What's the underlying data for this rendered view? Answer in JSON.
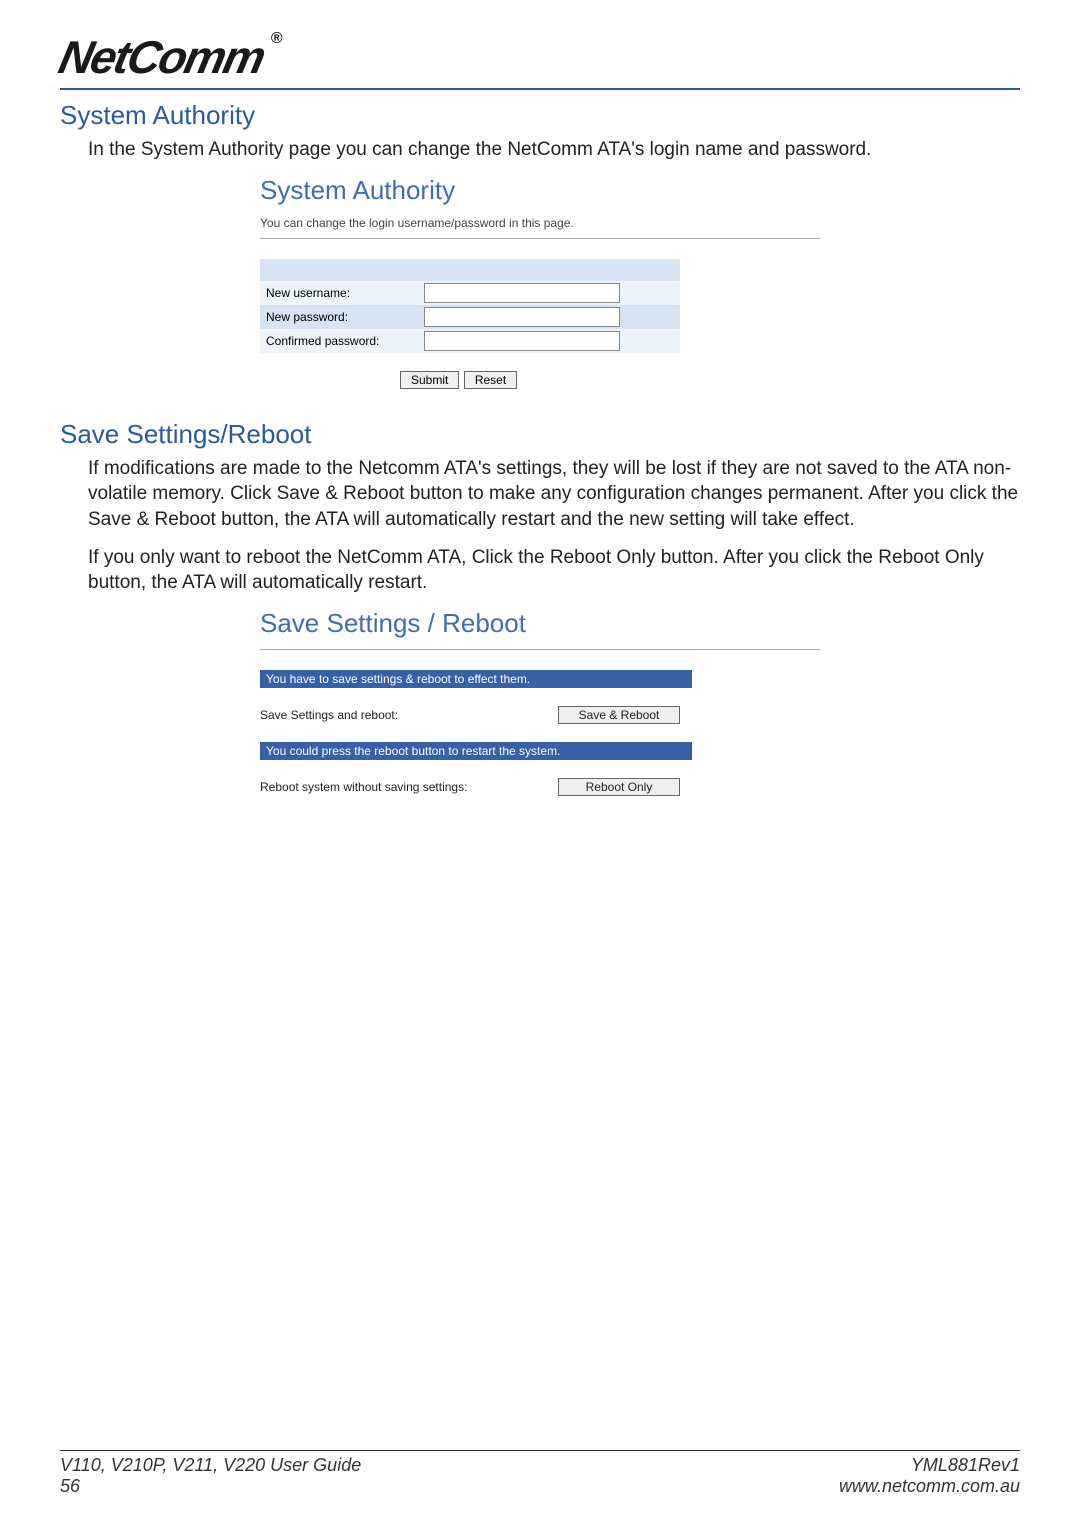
{
  "brand": "NetComm",
  "section1": {
    "title": "System Authority",
    "intro": "In the System Authority page you can change the NetComm ATA's login name and password.",
    "embed_title": "System Authority",
    "embed_sub": "You can change the login username/password in this page.",
    "fields": {
      "username_label": "New username:",
      "password_label": "New password:",
      "confirm_label": "Confirmed password:"
    },
    "buttons": {
      "submit": "Submit",
      "reset": "Reset"
    }
  },
  "section2": {
    "title": "Save Settings/Reboot",
    "p1": "If modifications are made to the Netcomm ATA's settings, they will be lost if they are not saved to the ATA non-volatile memory. Click Save & Reboot button to make any configuration changes permanent. After you click the Save & Reboot button, the ATA will automatically restart and the new setting will take effect.",
    "p2": "If you only want to reboot the NetComm ATA, Click the Reboot Only button. After you click the Reboot Only button, the ATA will automatically restart.",
    "embed_title": "Save Settings / Reboot",
    "bar1": "You have to save settings & reboot to effect them.",
    "row1_label": "Save Settings and reboot:",
    "row1_btn": "Save & Reboot",
    "bar2": "You could press the reboot button to restart the system.",
    "row2_label": "Reboot system without saving settings:",
    "row2_btn": "Reboot Only"
  },
  "footer": {
    "left1": "V110, V210P, V211, V220 User Guide",
    "right1": "YML881Rev1",
    "left2": "56",
    "right2": "www.netcomm.com.au"
  }
}
